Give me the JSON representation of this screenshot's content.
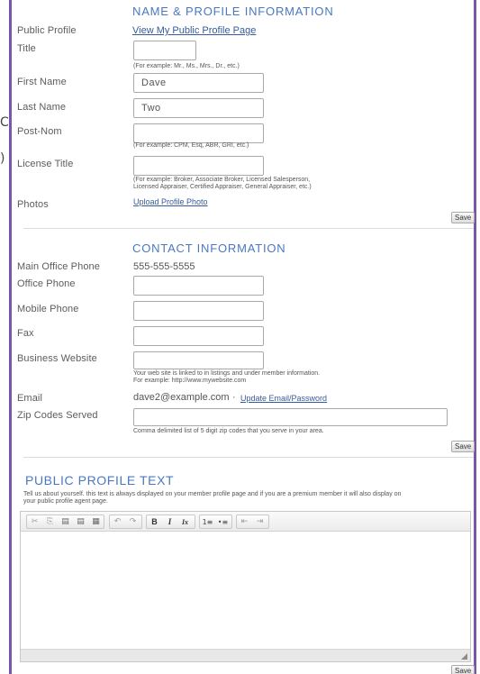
{
  "side_glyphs": [
    "C",
    ")"
  ],
  "name_section": {
    "heading": "NAME & PROFILE INFORMATION",
    "public_profile_label": "Public Profile",
    "public_profile_link": "View My Public Profile Page",
    "title_label": "Title",
    "title_value": "",
    "title_hint": "(For example: Mr., Ms., Mrs., Dr., etc.)",
    "first_name_label": "First Name",
    "first_name_value": "Dave",
    "last_name_label": "Last Name",
    "last_name_value": "Two",
    "post_nom_label": "Post-Nom",
    "post_nom_value": "",
    "post_nom_hint": "(For example: CPM, Esq, ABR, GRI, etc.)",
    "license_title_label": "License Title",
    "license_title_value": "",
    "license_title_hint_1": "(For example: Broker, Associate Broker, Licensed Salesperson,",
    "license_title_hint_2": "Licensed Appraiser, Certified Appraiser, General Appraiser, etc.)",
    "photos_label": "Photos",
    "upload_photo_link": "Upload Profile Photo",
    "save_label": "Save"
  },
  "contact_section": {
    "heading": "CONTACT INFORMATION",
    "main_office_phone_label": "Main Office Phone",
    "main_office_phone_value": "555-555-5555",
    "office_phone_label": "Office Phone",
    "mobile_phone_label": "Mobile Phone",
    "fax_label": "Fax",
    "business_website_label": "Business Website",
    "website_hint_1": "Your web site is linked to in listings and under member information.",
    "website_hint_2": "For example: http://www.mywebsite.com",
    "email_label": "Email",
    "email_value": "dave2@example.com",
    "email_separator": "·",
    "update_email_link": "Update Email/Password",
    "zip_label": "Zip Codes Served",
    "zip_hint": "Comma delimited list of 5 digit zip codes that you serve in your area.",
    "save_label": "Save"
  },
  "profile_text_section": {
    "heading": "PUBLIC PROFILE TEXT",
    "description_1": "Tell us about yourself. this text is always displayed on your member profile page and if you are a premium member it will also display on",
    "description_2": "your public profile agent page.",
    "toolbar": {
      "cut": "✂",
      "copy": "⎘",
      "paste": "▤",
      "paste_text": "▤",
      "paste_word": "▦",
      "undo": "↶",
      "redo": "↷",
      "bold": "B",
      "italic": "I",
      "remove_format": "Ix",
      "numbered_list": "1≡",
      "bulleted_list": "•≡",
      "outdent": "⇤",
      "indent": "⇥"
    },
    "save_label": "Save"
  }
}
